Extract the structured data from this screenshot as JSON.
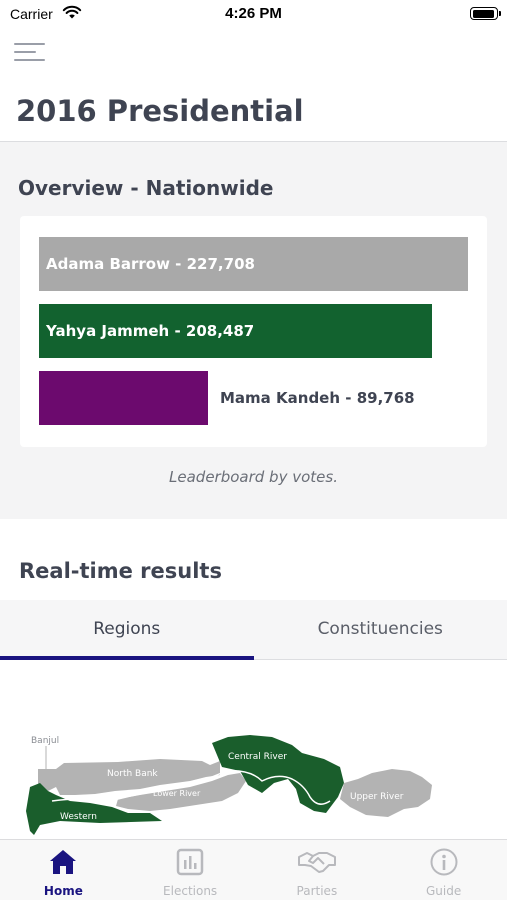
{
  "status_bar": {
    "carrier": "Carrier",
    "time": "4:26 PM"
  },
  "header": {
    "title": "2016 Presidential"
  },
  "overview": {
    "title": "Overview - Nationwide",
    "caption": "Leaderboard by votes."
  },
  "chart_data": {
    "type": "bar",
    "orientation": "horizontal",
    "categories": [
      "Adama Barrow",
      "Yahya Jammeh",
      "Mama Kandeh"
    ],
    "values": [
      227708,
      208487,
      89768
    ],
    "labels": [
      "Adama Barrow - 227,708",
      "Yahya Jammeh - 208,487",
      "Mama Kandeh - 89,768"
    ],
    "colors": [
      "#a9a9a9",
      "#12622f",
      "#6c0a6e"
    ],
    "title": "",
    "xlabel": "",
    "ylabel": "",
    "grid": false,
    "legend": "none"
  },
  "realtime": {
    "title": "Real-time results",
    "tabs": [
      {
        "label": "Regions",
        "active": true
      },
      {
        "label": "Constituencies",
        "active": false
      }
    ]
  },
  "map": {
    "regions": [
      "Banjul",
      "North Bank",
      "Central River",
      "Lower River",
      "Upper River",
      "Western"
    ],
    "colors": {
      "grey": "#b3b3b3",
      "green": "#1a5e2c"
    }
  },
  "tab_bar": {
    "items": [
      {
        "label": "Home",
        "icon": "home-icon",
        "active": true
      },
      {
        "label": "Elections",
        "icon": "bar-chart-icon",
        "active": false
      },
      {
        "label": "Parties",
        "icon": "handshake-icon",
        "active": false
      },
      {
        "label": "Guide",
        "icon": "info-icon",
        "active": false
      }
    ],
    "active_color": "#1a1480",
    "inactive_color": "#b8b9bd"
  }
}
